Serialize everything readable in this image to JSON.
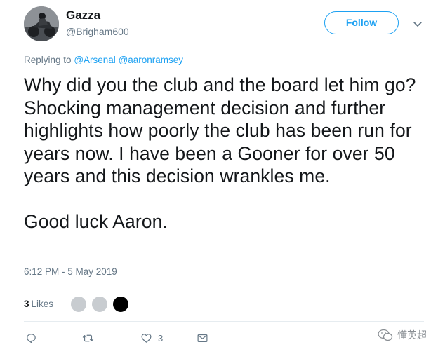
{
  "user": {
    "name": "Gazza",
    "handle": "@Brigham600"
  },
  "header": {
    "follow_label": "Follow"
  },
  "reply_context": {
    "prefix": "Replying to",
    "mentions": [
      "@Arsenal",
      "@aaronramsey"
    ]
  },
  "tweet": {
    "text": "Why did you the club and the board let him go? Shocking management decision and further highlights how poorly the club has been run for years now. I have been a Gooner for over 50 years and this decision wrankles me.\n\nGood luck Aaron.",
    "timestamp": "6:12 PM - 5 May 2019"
  },
  "stats": {
    "likes_count": "3",
    "likes_label": "Likes",
    "liker_colors": [
      "#c8ccd0",
      "#c8ccd0",
      "#000000"
    ]
  },
  "actions": {
    "reply_icon": "reply-icon",
    "retweet_icon": "retweet-icon",
    "like_icon": "heart-icon",
    "like_count": "3",
    "message_icon": "envelope-icon"
  },
  "watermark": {
    "text": "懂英超",
    "icon": "wechat-icon"
  },
  "colors": {
    "accent": "#1da1f2",
    "secondary_text": "#657786",
    "divider": "#e6ecf0"
  }
}
